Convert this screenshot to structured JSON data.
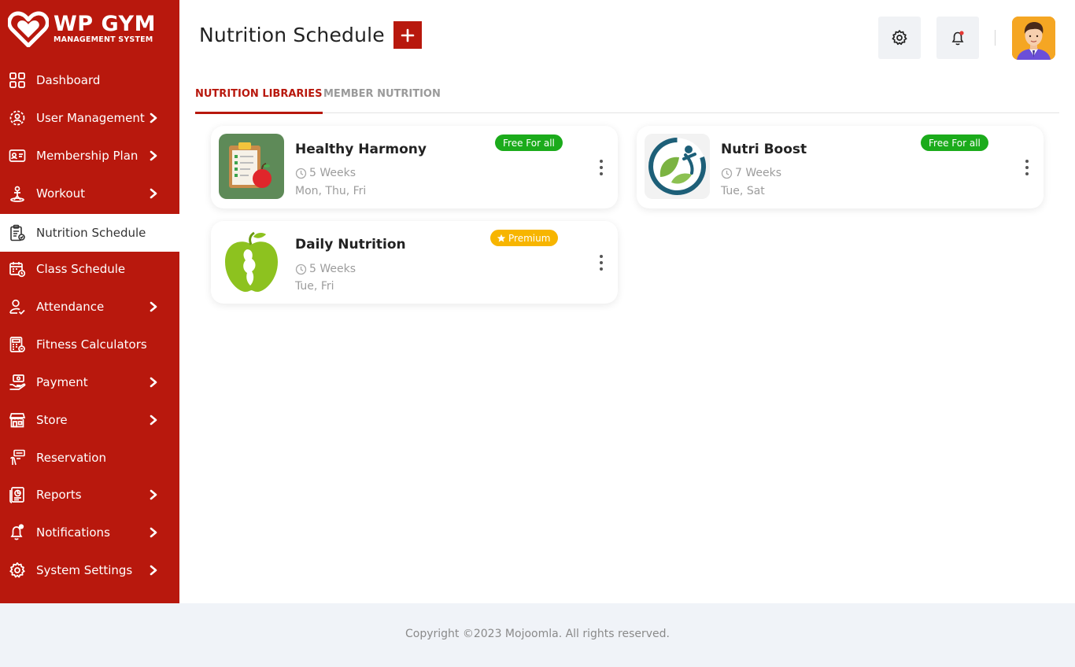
{
  "brand": {
    "title": "WP GYM",
    "subtitle": "MANAGEMENT SYSTEM"
  },
  "sidebar": {
    "items": [
      {
        "label": "Dashboard",
        "icon": "dashboard-icon",
        "has_arrow": false,
        "active": false
      },
      {
        "label": "User Management",
        "icon": "users-gear-icon",
        "has_arrow": true,
        "active": false
      },
      {
        "label": "Membership Plan",
        "icon": "membership-card-icon",
        "has_arrow": true,
        "active": false
      },
      {
        "label": "Workout",
        "icon": "workout-icon",
        "has_arrow": true,
        "active": false
      },
      {
        "label": "Nutrition Schedule",
        "icon": "clipboard-nutrition-icon",
        "has_arrow": false,
        "active": true
      },
      {
        "label": "Class Schedule",
        "icon": "calendar-icon",
        "has_arrow": false,
        "active": false
      },
      {
        "label": "Attendance",
        "icon": "user-check-icon",
        "has_arrow": true,
        "active": false
      },
      {
        "label": "Fitness Calculators",
        "icon": "calculator-icon",
        "has_arrow": false,
        "active": false
      },
      {
        "label": "Payment",
        "icon": "payment-hand-icon",
        "has_arrow": true,
        "active": false
      },
      {
        "label": "Store",
        "icon": "store-icon",
        "has_arrow": true,
        "active": false
      },
      {
        "label": "Reservation",
        "icon": "reservation-icon",
        "has_arrow": false,
        "active": false
      },
      {
        "label": "Reports",
        "icon": "report-icon",
        "has_arrow": true,
        "active": false
      },
      {
        "label": "Notifications",
        "icon": "bell-icon",
        "has_arrow": true,
        "active": false
      },
      {
        "label": "System Settings",
        "icon": "gear-icon",
        "has_arrow": true,
        "active": false
      }
    ]
  },
  "header": {
    "title": "Nutrition Schedule"
  },
  "tabs": [
    {
      "label": "NUTRITION LIBRARIES",
      "active": true
    },
    {
      "label": "MEMBER NUTRITION",
      "active": false
    }
  ],
  "cards": [
    {
      "title": "Healthy Harmony",
      "duration": "5 Weeks",
      "days": "Mon, Thu, Fri",
      "badge": "Free For all",
      "badge_type": "free"
    },
    {
      "title": "Nutri Boost",
      "duration": "7 Weeks",
      "days": "Tue, Sat",
      "badge": "Free For all",
      "badge_type": "free"
    },
    {
      "title": "Daily Nutrition",
      "duration": "5 Weeks",
      "days": "Tue, Fri",
      "badge": "Premium",
      "badge_type": "premium"
    }
  ],
  "footer": {
    "text": "Copyright ©2023 Mojoomla. All rights reserved."
  },
  "colors": {
    "brand_red": "#b8180d",
    "free_green": "#1bab1b",
    "premium_yellow": "#f7b500"
  }
}
